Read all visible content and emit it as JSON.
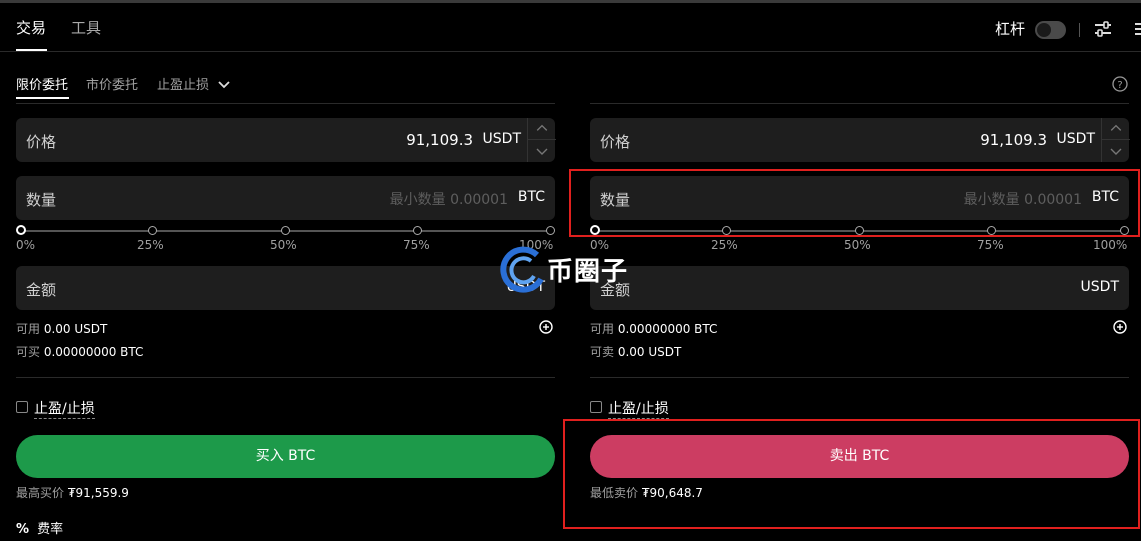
{
  "header": {
    "tabs": [
      {
        "label": "交易"
      },
      {
        "label": "工具"
      }
    ],
    "leverage_label": "杠杆"
  },
  "order_types": [
    "限价委托",
    "市价委托",
    "止盈止损"
  ],
  "buy": {
    "price": {
      "label": "价格",
      "value": "91,109.3",
      "unit": "USDT"
    },
    "quantity": {
      "label": "数量",
      "placeholder": "最小数量 0.00001",
      "unit": "BTC"
    },
    "slider": {
      "ticks": [
        "0%",
        "25%",
        "50%",
        "75%",
        "100%"
      ],
      "value_percent": 0
    },
    "amount": {
      "label": "金额",
      "unit": "USDT"
    },
    "available_label": "可用",
    "available_value": "0.00 USDT",
    "can_label": "可买",
    "can_value": "0.00000000 BTC",
    "tpsl_label": "止盈/止损",
    "button_label": "买入 BTC",
    "price_note_label": "最高买价",
    "price_note_value": "₮91,559.9"
  },
  "sell": {
    "price": {
      "label": "价格",
      "value": "91,109.3",
      "unit": "USDT"
    },
    "quantity": {
      "label": "数量",
      "placeholder": "最小数量 0.00001",
      "unit": "BTC"
    },
    "slider": {
      "ticks": [
        "0%",
        "25%",
        "50%",
        "75%",
        "100%"
      ],
      "value_percent": 0
    },
    "amount": {
      "label": "金额",
      "unit": "USDT"
    },
    "available_label": "可用",
    "available_value": "0.00000000 BTC",
    "can_label": "可卖",
    "can_value": "0.00 USDT",
    "tpsl_label": "止盈/止损",
    "button_label": "卖出 BTC",
    "price_note_label": "最低卖价",
    "price_note_value": "₮90,648.7"
  },
  "fee_label": "费率",
  "watermark_text": "币圈子",
  "colors": {
    "buy": "#1d9a4a",
    "sell": "#cc3d62",
    "highlight": "#e0201e"
  }
}
